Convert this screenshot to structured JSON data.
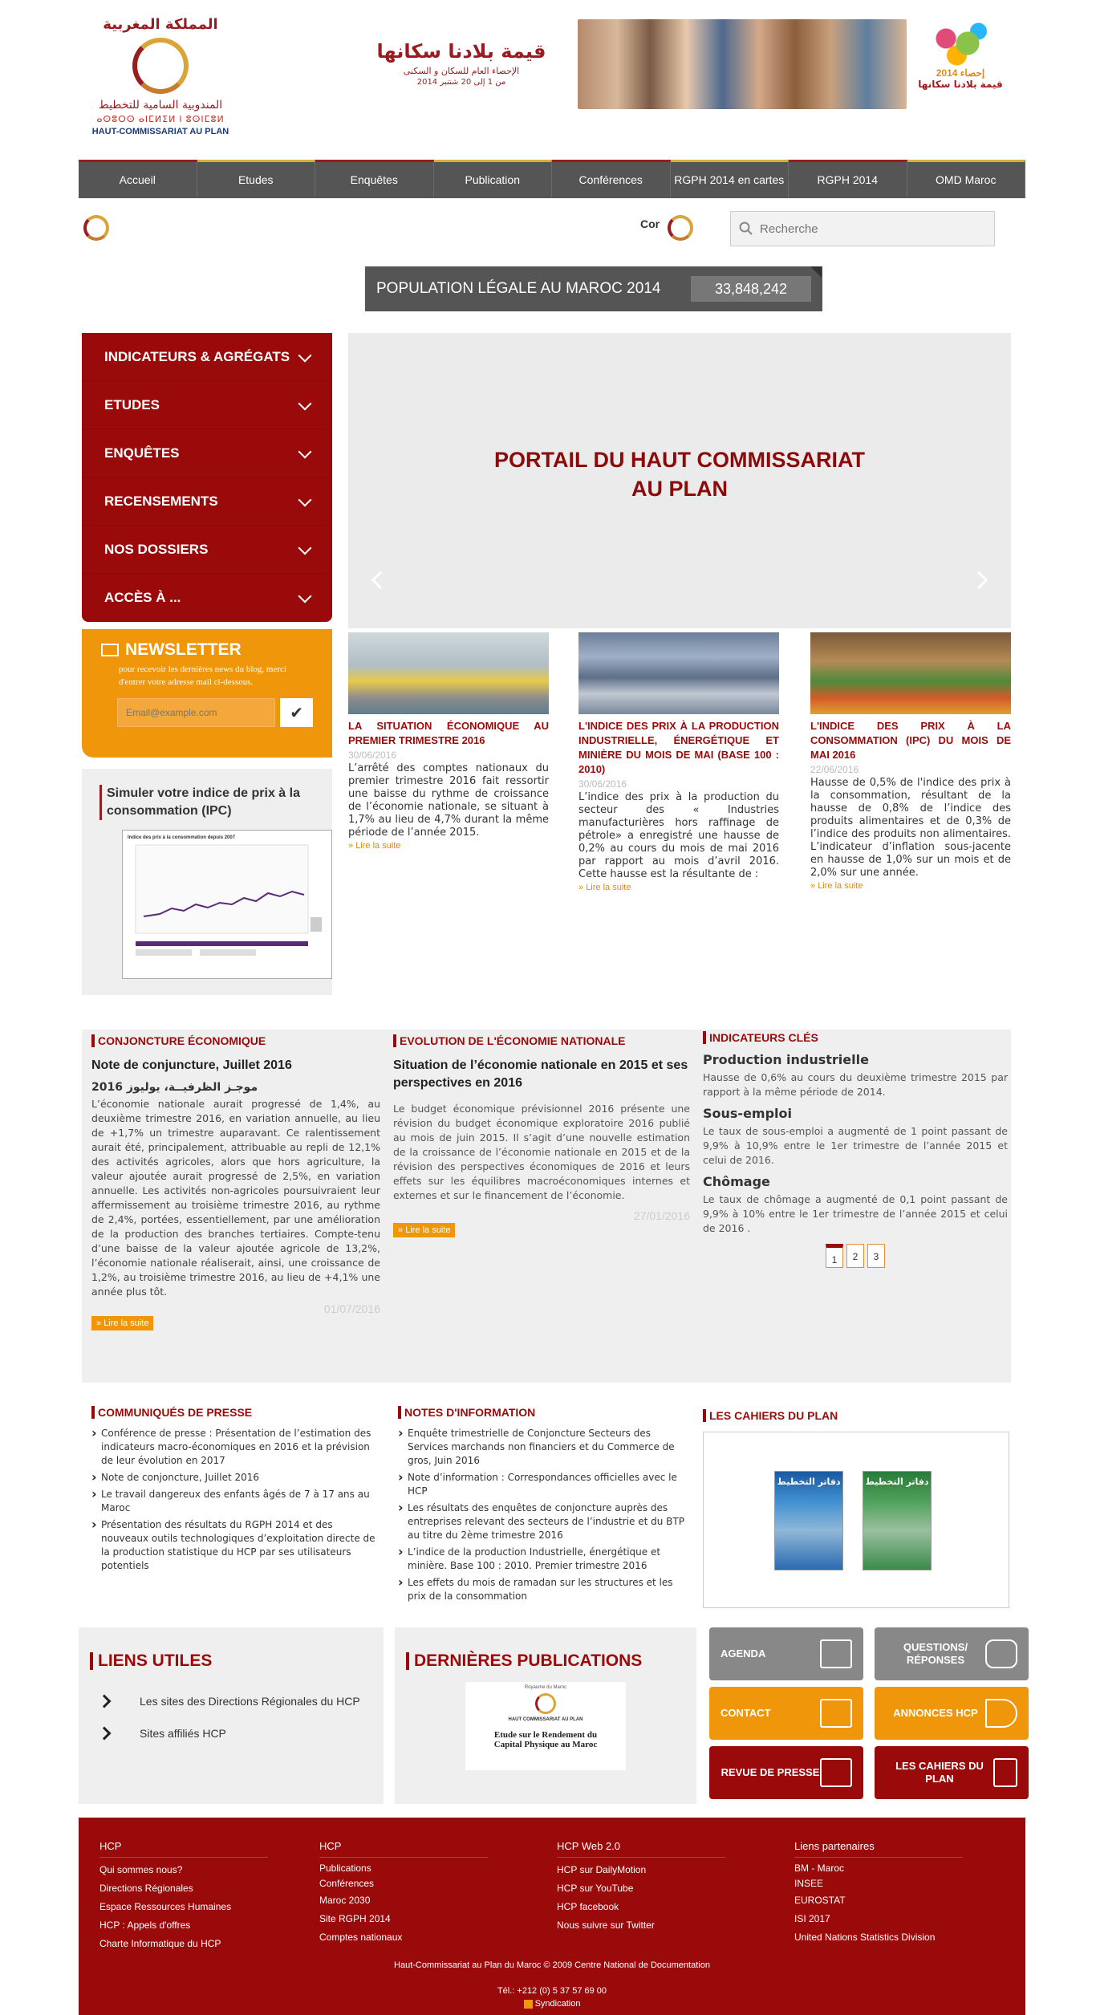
{
  "header": {
    "logo_ar": "المملكة المغربية",
    "logo_ar2": "المندوبية السامية للتخطيط",
    "logo_tif": "ⴰⵙⵓⵔⵙ ⴰⵏⵎⵍⵉⵍ ⵏ ⵓⵙⵏⵎⵓⵍ",
    "logo_fr": "HAUT-COMMISSARIAT AU PLAN",
    "banner_ar1": "قيمة بلادنا سكانها",
    "banner_ar2": "الإحصاء العام للسكان و السكنى",
    "banner_ar3": "من 1 إلى 20 شتنبر 2014",
    "rgph_t1": "2014 إحصاء",
    "rgph_t2": "قيمة بلادنا سكانها"
  },
  "nav": [
    "Accueil",
    "Etudes",
    "Enquêtes",
    "Publication",
    "Conférences",
    "RGPH 2014 en cartes",
    "RGPH 2014",
    "OMD Maroc"
  ],
  "subheader": {
    "ticker": "Cor",
    "search_placeholder": "Recherche"
  },
  "population": {
    "label": "POPULATION LÉGALE AU MAROC 2014",
    "value": "33,848,242"
  },
  "left_menu": [
    "INDICATEURS & AGRÉGATS",
    "ETUDES",
    "ENQUÊTES",
    "RECENSEMENTS",
    "NOS DOSSIERS",
    "ACCÈS À ..."
  ],
  "newsletter": {
    "title": "NEWSLETTER",
    "desc": "pour recevoir les dernières news du blog, merci d'entrer votre adresse mail ci-dessous.",
    "placeholder": "Email@example.com",
    "button": "✔"
  },
  "ipc": {
    "title": "Simuler votre indice de prix à la consommation (IPC)",
    "chart_caption": "Indice des prix à la consommation depuis 2007"
  },
  "slider": {
    "title_line1": "PORTAIL DU HAUT COMMISSARIAT",
    "title_line2": "AU PLAN"
  },
  "cards": [
    {
      "title": "LA SITUATION ÉCONOMIQUE AU PREMIER TRIMESTRE 2016",
      "date": "30/06/2016",
      "text": "L’arrêté des comptes nationaux du premier trimestre 2016 fait ressortir une baisse du rythme de croissance de l’économie nationale, se situant à 1,7% au lieu de 4,7% durant la même période de l’année 2015.",
      "more": "Lire la suite"
    },
    {
      "title": "L'INDICE DES PRIX À LA PRODUCTION INDUSTRIELLE, ÉNERGÉTIQUE ET MINIÈRE DU MOIS DE MAI (BASE 100 : 2010)",
      "date": "30/06/2016",
      "text": "L’indice des prix à la production du secteur des « Industries manufacturières hors raffinage de pétrole» a enregistré une hausse de 0,2% au cours du mois de mai 2016 par rapport au mois d’avril 2016. Cette hausse est la résultante de :",
      "more": "Lire la suite"
    },
    {
      "title": "L'INDICE DES PRIX À LA CONSOMMATION (IPC) DU MOIS DE MAI 2016",
      "date": "22/06/2016",
      "text": "Hausse de 0,5% de l'indice des prix à la consommation, résultant de la hausse de 0,8% de l’indice des produits alimentaires et de 0,3% de l’indice des produits non alimentaires. L’indicateur d’inflation sous-jacente en hausse de 1,0% sur un mois et de 2,0% sur une année.",
      "more": "Lire la suite"
    }
  ],
  "conjoncture": {
    "head": "CONJONCTURE ÉCONOMIQUE",
    "title": "Note de conjuncture, Juillet 2016",
    "subtitle_ar": "موجـز الظرفيــة، يوليوز 2016",
    "text": "L’économie nationale aurait progressé de 1,4%, au deuxième trimestre 2016, en variation annuelle, au lieu de +1,7% un trimestre auparavant. Ce ralentissement aurait été, principalement, attribuable au repli de 12,1% des activités agricoles, alors que hors agriculture, la valeur ajoutée aurait progressé de 2,5%, en variation annuelle. Les activités non-agricoles poursuivraient leur affermissement au troisième trimestre 2016, au rythme de 2,4%, portées, essentiellement, par une amélioration de la production des branches tertiaires. Compte-tenu d’une baisse de la valeur ajoutée agricole de 13,2%, l’économie nationale réaliserait, ainsi, une croissance de 1,2%, au troisième trimestre 2016, au lieu de +4,1% une année plus tôt.",
    "more": "Lire la suite",
    "date": "01/07/2016"
  },
  "evolution": {
    "head": "EVOLUTION DE L'ÉCONOMIE NATIONALE",
    "title": "Situation de l’économie nationale en 2015 et ses perspectives en 2016",
    "text": "Le budget économique prévisionnel 2016 présente une révision du budget économique exploratoire 2016 publié au mois de juin 2015. Il s’agit d’une nouvelle estimation de la croissance de l’économie nationale en 2015 et de la révision des perspectives économiques de 2016 et leurs effets sur les équilibres macroéconomiques internes et externes et sur le financement de l’économie.",
    "date": "27/01/2016",
    "more": "Lire la suite"
  },
  "indicateurs": {
    "head": "INDICATEURS CLÉS",
    "items": [
      {
        "title": "Production industrielle",
        "text": "Hausse de 0,6% au cours du deuxième trimestre 2015 par rapport à la même période de 2014."
      },
      {
        "title": "Sous-emploi",
        "text": "Le taux de sous-emploi a augmenté de 1 point passant de 9,9% à 10,9% entre le 1er trimestre de l’année 2015 et celui de 2016."
      },
      {
        "title": "Chômage",
        "text": "Le taux de chômage a augmenté de 0,1 point passant de 9,9% à 10% entre le 1er trimestre de l’année 2015 et celui de 2016 ."
      }
    ],
    "pages": [
      "1",
      "2",
      "3"
    ]
  },
  "communiques": {
    "head": "COMMUNIQUÉS DE PRESSE",
    "items": [
      "Conférence de presse : Présentation de l’estimation des indicateurs macro-économiques en 2016 et la prévision de leur évolution en 2017",
      "Note de conjoncture, Juillet 2016",
      "Le travail dangereux des enfants âgés de 7 à 17 ans au Maroc",
      "Présentation des résultats du RGPH 2014 et des nouveaux outils technologiques d’exploitation directe de la production statistique du HCP par ses utilisateurs potentiels"
    ]
  },
  "notes": {
    "head": "NOTES D'INFORMATION",
    "items": [
      "Enquête trimestrielle de Conjoncture Secteurs des Services marchands non financiers et du Commerce de gros, Juin 2016",
      "Note d’information : Correspondances officielles avec le HCP",
      "Les résultats des enquêtes de conjoncture auprès des entreprises relevant des secteurs de l’industrie et du BTP au titre du 2ème trimestre 2016",
      "L’indice de la production Industrielle, énergétique et minière. Base 100 : 2010. Premier trimestre 2016",
      "Les effets du mois de ramadan sur les structures et les prix de la consommation"
    ]
  },
  "cahiers": {
    "head": "LES CAHIERS DU PLAN",
    "cover_ar": "دفاتر التخطيط"
  },
  "liens": {
    "head": "LIENS UTILES",
    "items": [
      "Les sites des Directions Régionales du HCP",
      "Sites affiliés HCP"
    ]
  },
  "publications": {
    "head": "DERNIÈRES PUBLICATIONS",
    "doc_top": "Royaume du Maroc",
    "doc_org": "HAUT COMMISSARIAT AU PLAN",
    "doc_title": "Etude sur le Rendement du Capital Physique au Maroc"
  },
  "tiles": [
    {
      "label": "AGENDA",
      "color": "#888888",
      "icon": "calendar-icon"
    },
    {
      "label": "QUESTIONS/ RÉPONSES",
      "color": "#888888",
      "icon": "chat-icon"
    },
    {
      "label": "CONTACT",
      "color": "#f0960a",
      "icon": "contact-card-icon"
    },
    {
      "label": "ANNONCES HCP",
      "color": "#f0960a",
      "icon": "megaphone-icon"
    },
    {
      "label": "REVUE DE PRESSE",
      "color": "#9b0a0a",
      "icon": "newspaper-icon"
    },
    {
      "label": "LES CAHIERS DU PLAN",
      "color": "#9b0a0a",
      "icon": "book-icon"
    }
  ],
  "footer": {
    "cols": [
      {
        "head": "HCP",
        "links": [
          "Qui sommes nous?",
          "Directions Régionales",
          "Espace Ressources Humaines",
          "HCP : Appels d'offres",
          "Charte Informatique du HCP"
        ]
      },
      {
        "head": "HCP",
        "links": [
          "Publications",
          "Conférences",
          "Maroc 2030",
          "Site RGPH 2014",
          "Comptes nationaux"
        ]
      },
      {
        "head": "HCP Web 2.0",
        "links": [
          "HCP sur DailyMotion",
          "HCP sur YouTube",
          "HCP facebook",
          "Nous suivre sur Twitter"
        ]
      },
      {
        "head": "Liens partenaires",
        "links": [
          "BM - Maroc",
          "INSEE",
          "EUROSTAT",
          "ISI 2017",
          "United Nations Statistics Division"
        ]
      }
    ],
    "copyright": "Haut-Commissariat au Plan du Maroc © 2009 Centre National de Documentation",
    "tel": "Tél.: +212 (0) 5 37 57 69 00",
    "rss": "Syndication"
  }
}
